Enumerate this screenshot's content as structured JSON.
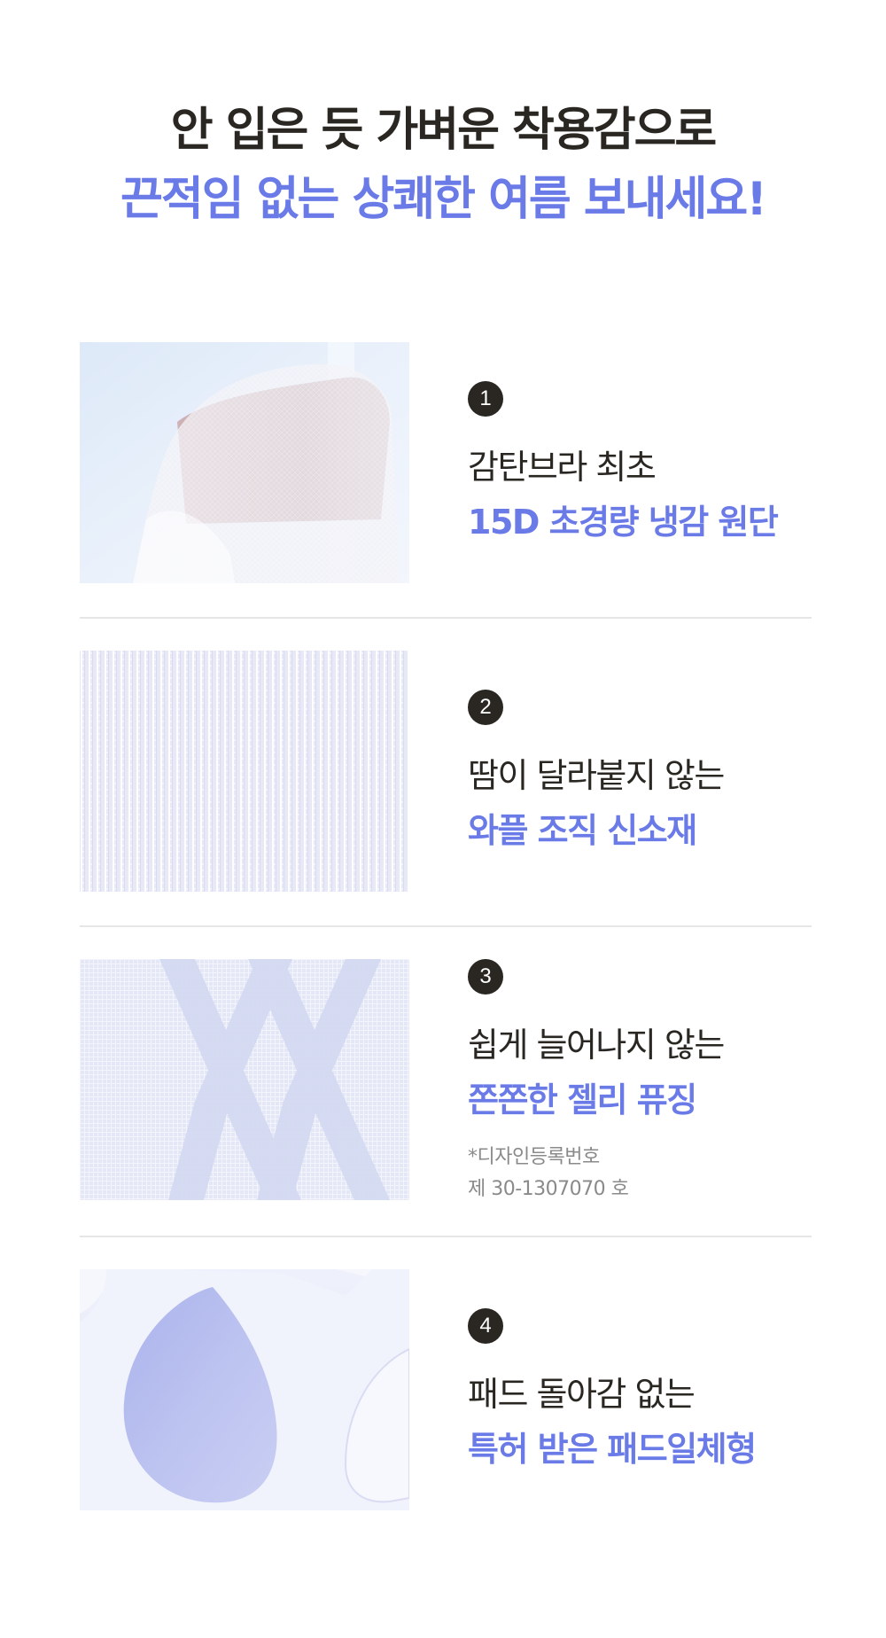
{
  "headline": {
    "line1": "안 입은 듯 가벼운 착용감으로",
    "line2": "끈적임 없는 상쾌한 여름 보내세요!"
  },
  "features": [
    {
      "number": "1",
      "line1": "감탄브라 최초",
      "line2": "15D 초경량 냉감 원단"
    },
    {
      "number": "2",
      "line1": "땀이 달라붙지 않는",
      "line2": "와플 조직 신소재"
    },
    {
      "number": "3",
      "line1": "쉽게 늘어나지 않는",
      "line2": "쫀쫀한 젤리 퓨징",
      "note1": "*디자인등록번호",
      "note2": "제 30-1307070 호"
    },
    {
      "number": "4",
      "line1": "패드 돌아감 없는",
      "line2": "특허 받은 패드일체형"
    }
  ],
  "colors": {
    "accent": "#6a7be8",
    "dark": "#2a2723",
    "note": "#8a8a8a",
    "divider": "#e6e6e6"
  }
}
